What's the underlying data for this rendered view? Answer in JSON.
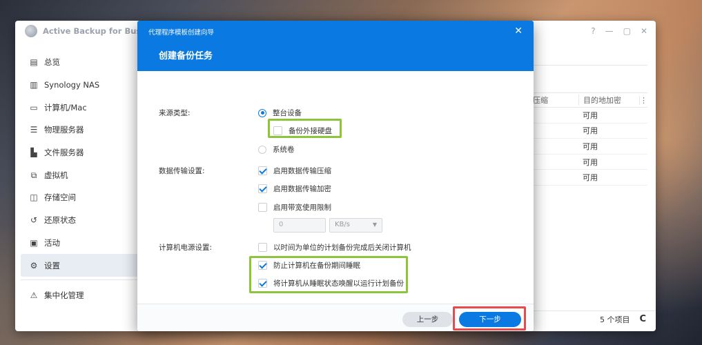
{
  "app": {
    "title": "Active Backup for Business",
    "window_controls": [
      "?",
      "—",
      "▢",
      "✕"
    ]
  },
  "sidebar": {
    "items": [
      {
        "label": "总览",
        "icon": "overview-icon"
      },
      {
        "label": "Synology NAS",
        "icon": "nas-icon"
      },
      {
        "label": "计算机/Mac",
        "icon": "computer-icon"
      },
      {
        "label": "物理服务器",
        "icon": "server-icon"
      },
      {
        "label": "文件服务器",
        "icon": "file-server-icon"
      },
      {
        "label": "虚拟机",
        "icon": "vm-icon"
      },
      {
        "label": "存储空间",
        "icon": "storage-icon"
      },
      {
        "label": "还原状态",
        "icon": "restore-icon"
      },
      {
        "label": "活动",
        "icon": "activity-icon"
      },
      {
        "label": "设置",
        "icon": "gear-icon"
      }
    ],
    "bottom_item": {
      "label": "集中化管理",
      "icon": "central-management-icon"
    },
    "active_index": 9
  },
  "background_table": {
    "headers": [
      "压缩",
      "目的地加密"
    ],
    "rows": [
      "可用",
      "可用",
      "可用",
      "可用",
      "可用"
    ],
    "footer_count": "5 个项目"
  },
  "dialog": {
    "wizard_title": "代理程序模板创建向导",
    "title": "创建备份任务",
    "source_type_label": "来源类型:",
    "source_options": [
      "整台设备",
      "系统卷"
    ],
    "source_selected": "整台设备",
    "external_drive_label": "备份外接硬盘",
    "external_drive_checked": false,
    "transfer_label": "数据传输设置:",
    "transfer_options": [
      {
        "label": "启用数据传输压缩",
        "checked": true
      },
      {
        "label": "启用数据传输加密",
        "checked": true
      },
      {
        "label": "启用带宽使用限制",
        "checked": false
      }
    ],
    "bandwidth_value": "0",
    "bandwidth_unit": "KB/s",
    "power_label": "计算机电源设置:",
    "power_options": [
      {
        "label": "以时间为单位的计划备份完成后关闭计算机",
        "checked": false
      },
      {
        "label": "防止计算机在备份期间睡眠",
        "checked": true
      },
      {
        "label": "将计算机从睡眠状态唤醒以运行计划备份",
        "checked": true
      }
    ],
    "prev_button": "上一步",
    "next_button": "下一步"
  },
  "colors": {
    "accent": "#0a7ae2",
    "highlight_green": "#8cc43c",
    "highlight_red": "#e84a4a"
  }
}
